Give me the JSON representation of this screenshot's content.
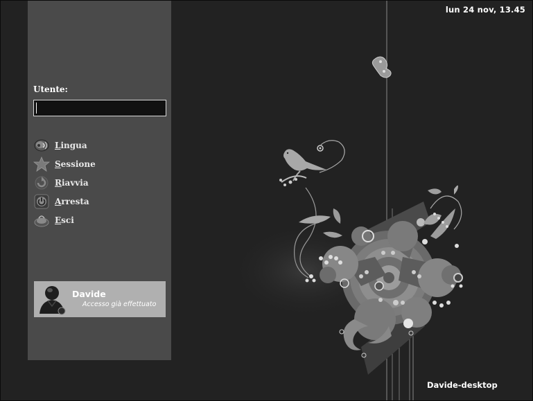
{
  "clock": "lun 24 nov, 13.45",
  "hostname": "Davide-desktop",
  "login": {
    "user_label": "Utente:",
    "username_value": ""
  },
  "menu": {
    "items": [
      {
        "label_first": "L",
        "label_rest": "ingua",
        "icon": "language-icon"
      },
      {
        "label_first": "S",
        "label_rest": "essione",
        "icon": "session-star-icon"
      },
      {
        "label_first": "R",
        "label_rest": "iavvia",
        "icon": "restart-icon"
      },
      {
        "label_first": "A",
        "label_rest": "rresta",
        "icon": "power-icon"
      },
      {
        "label_first": "E",
        "label_rest": "sci",
        "icon": "exit-icon"
      }
    ]
  },
  "user_card": {
    "name": "Davide",
    "status": "Accesso già effettuato"
  },
  "colors": {
    "background": "#222222",
    "panel": "#4a4a4a",
    "user_card": "#b0b0b0",
    "text": "#ffffff"
  }
}
